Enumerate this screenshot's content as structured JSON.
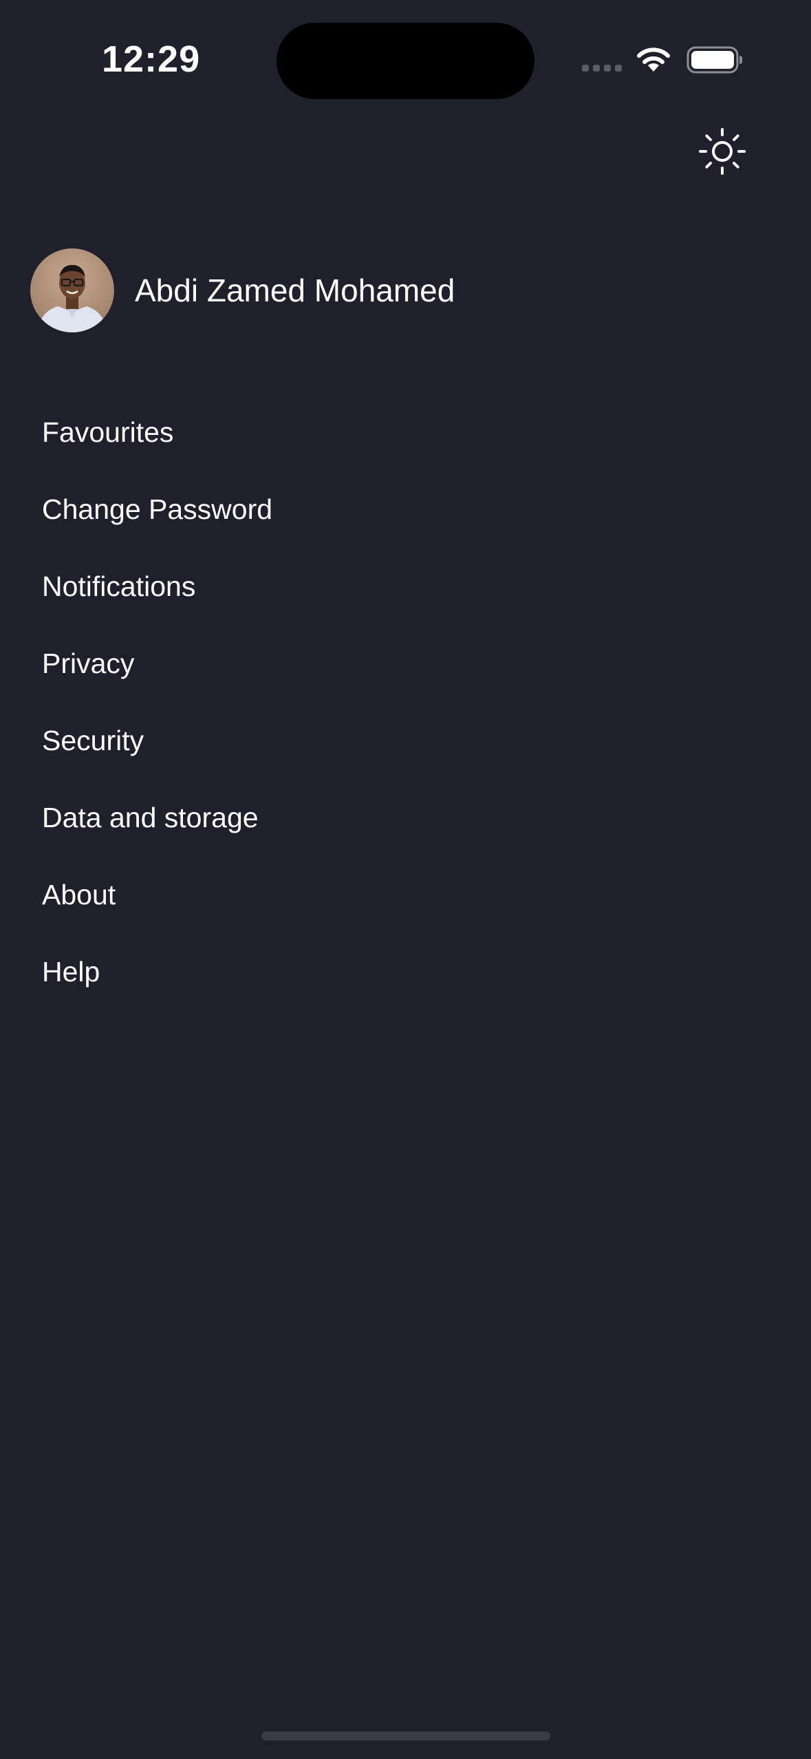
{
  "status_bar": {
    "time": "12:29"
  },
  "colors": {
    "background": "#1f202b",
    "text": "#ffffff",
    "home_indicator": "#3a3b45"
  },
  "icons": {
    "theme_toggle": "sun-icon",
    "wifi": "wifi-icon",
    "battery": "battery-icon",
    "signal": "cellular-signal-icon"
  },
  "profile": {
    "name": "Abdi Zamed Mohamed"
  },
  "menu": {
    "items": [
      {
        "label": "Favourites"
      },
      {
        "label": "Change Password"
      },
      {
        "label": "Notifications"
      },
      {
        "label": "Privacy"
      },
      {
        "label": "Security"
      },
      {
        "label": "Data and storage"
      },
      {
        "label": "About"
      },
      {
        "label": "Help"
      }
    ]
  }
}
